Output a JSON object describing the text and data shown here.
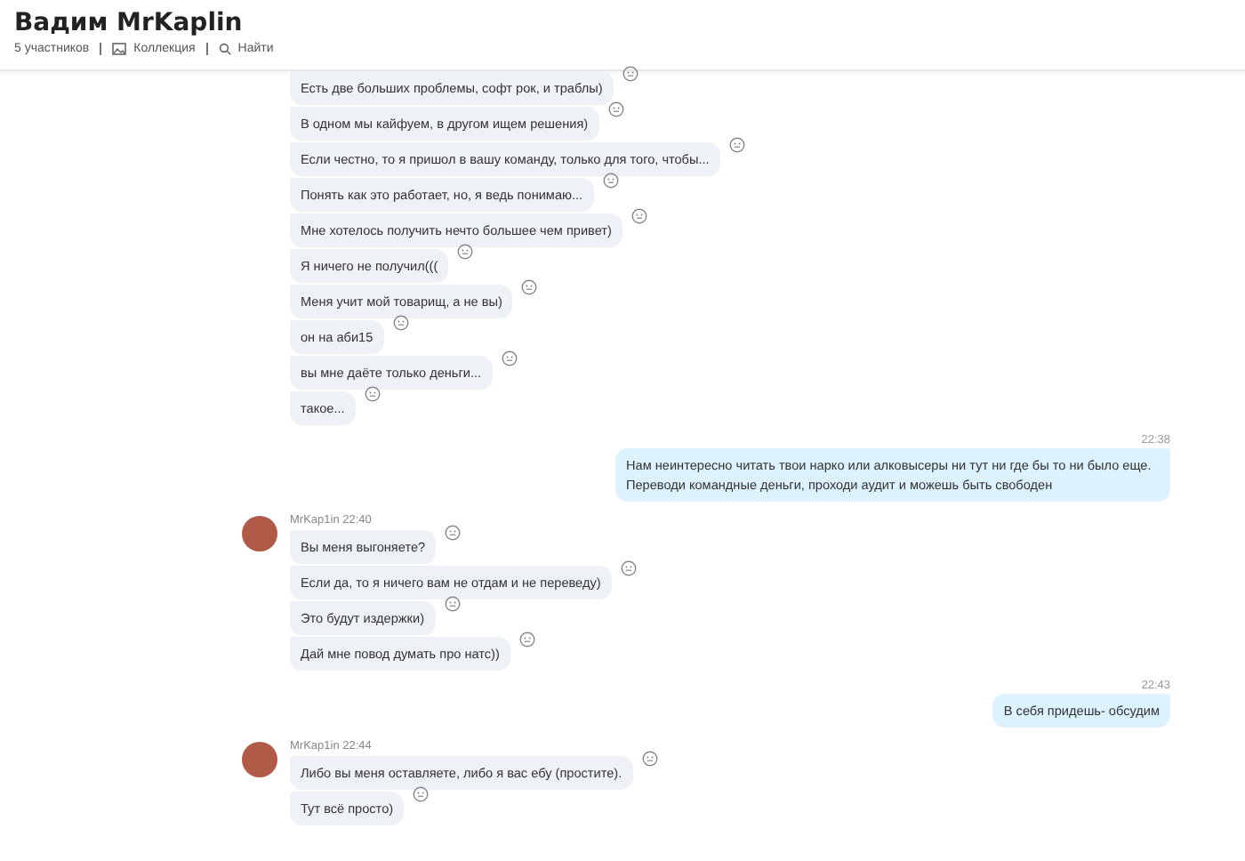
{
  "header": {
    "title": "Вадим MrKaplin",
    "participants": "5 участников",
    "gallery": "Коллекция",
    "search": "Найти"
  },
  "groups": [
    {
      "kind": "incoming",
      "messages": [
        "Есть две больших проблемы, софт рок, и траблы)",
        "В одном мы кайфуем, в другом ищем решения)",
        "Если честно, то я пришол в вашу команду, только для того, чтобы...",
        "Понять как это работает, но, я ведь понимаю...",
        "Мне хотелось получить нечто большее чем привет)",
        "Я ничего не получил(((",
        "Меня учит мой товарищ, а не вы)",
        "он на аби15",
        "вы мне даёте только деньги...",
        "такое..."
      ]
    },
    {
      "kind": "outgoing",
      "time": "22:38",
      "messages": [
        "Нам неинтересно читать твои нарко или алковысеры ни тут ни где бы то ни было еще. Переводи командные деньги, проходи аудит и можешь быть свободен"
      ]
    },
    {
      "kind": "incoming",
      "sender": "MrKap1in",
      "time": "22:40",
      "messages": [
        "Вы меня выгоняете?",
        "Если да, то я ничего вам не отдам и не переведу)",
        "Это будут издержки)",
        "Дай мне повод думать про натс))"
      ]
    },
    {
      "kind": "outgoing",
      "time": "22:43",
      "messages": [
        "В себя придешь- обсудим"
      ]
    },
    {
      "kind": "incoming",
      "sender": "MrKap1in",
      "time": "22:44",
      "messages": [
        "Либо вы меня оставляете, либо я вас ебу (простите).",
        "Тут всё просто)"
      ]
    }
  ]
}
